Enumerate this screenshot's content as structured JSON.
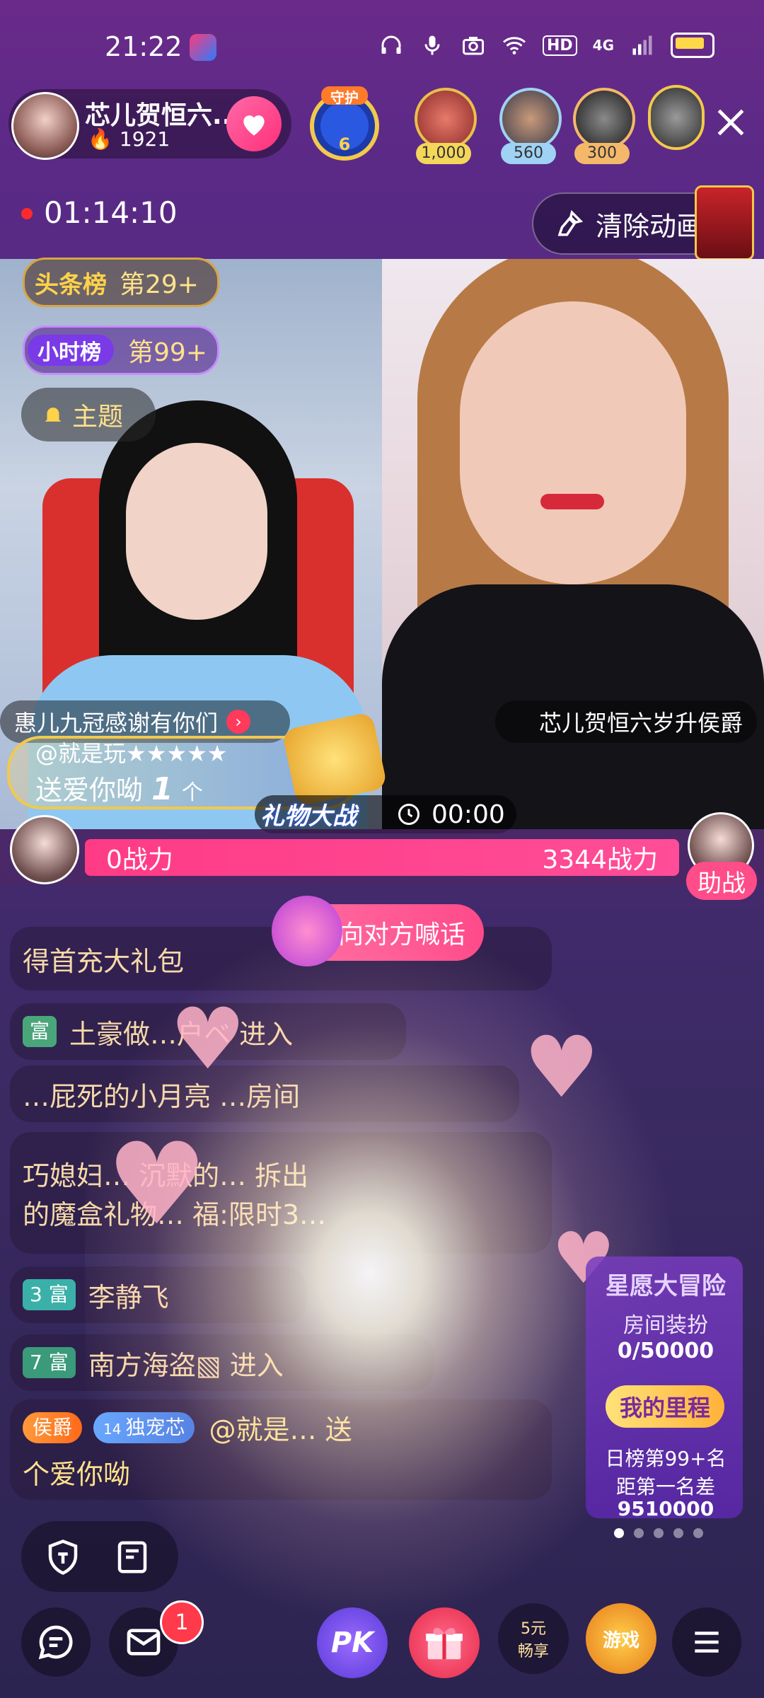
{
  "status_bar": {
    "time": "21:22",
    "network": "4G",
    "hd": "HD",
    "icons": [
      "headset-icon",
      "mic-icon",
      "camera-icon",
      "wifi-icon",
      "signal-icon",
      "battery-icon"
    ]
  },
  "header": {
    "host_name": "芯儿贺恒六...",
    "host_fans": "1921",
    "guard_label": "守护",
    "guard_month": "6",
    "viewers": [
      {
        "count": "1,000",
        "color": "#f4d65a"
      },
      {
        "count": "560",
        "color": "#9fd2f4"
      },
      {
        "count": "300",
        "color": "#f4b86a"
      }
    ]
  },
  "timer": {
    "elapsed": "01:14:10",
    "clear_animation_label": "清除动画"
  },
  "left_pane": {
    "rank1_tag": "头条榜",
    "rank1_value": "第29+",
    "rank2_tag": "小时榜",
    "rank2_value": "第99+",
    "topic_label": "主题",
    "name_label": "惠儿九冠感谢有你们",
    "gift_user": "@就是玩★★★★★",
    "gift_text": "送爱你呦",
    "gift_count": "1",
    "gift_unit": "个"
  },
  "right_pane": {
    "name_label": "芯儿贺恒六岁升侯爵"
  },
  "battle": {
    "title": "礼物大战",
    "timer": "00:00",
    "left_power": "0战力",
    "right_power": "3344战力",
    "assist_label": "助战",
    "shout_label": "向对方喊话"
  },
  "chat": [
    {
      "text": "得首充大礼包"
    },
    {
      "badge": "富",
      "text": "土豪做…户ベ 进入"
    },
    {
      "text": "…屁死的小月亮 …房间"
    },
    {
      "text": "巧媳妇… 沉默的… 拆出"
    },
    {
      "text": "的魔盒礼物… 福:限时3…"
    },
    {
      "badge": "3 富",
      "text": "李静飞"
    },
    {
      "badge": "7 富",
      "text": "南方海盗▧ 进入"
    }
  ],
  "last_chat": {
    "noble_badge": "侯爵",
    "fan_badge": "独宠芯",
    "fan_level": "14",
    "text": "@就是… 送",
    "line2": "个爱你呦"
  },
  "event_card": {
    "title": "星愿大冒险",
    "subtitle": "房间装扮",
    "progress": "0/50000",
    "button": "我的里程",
    "rank": "日榜第99+名",
    "gap_label": "距第一名差",
    "gap_value": "9510000"
  },
  "bottom": {
    "notif_count": "1",
    "pk_label": "PK",
    "promo_line1": "5元",
    "promo_line2": "畅享",
    "game_label": "游戏"
  }
}
